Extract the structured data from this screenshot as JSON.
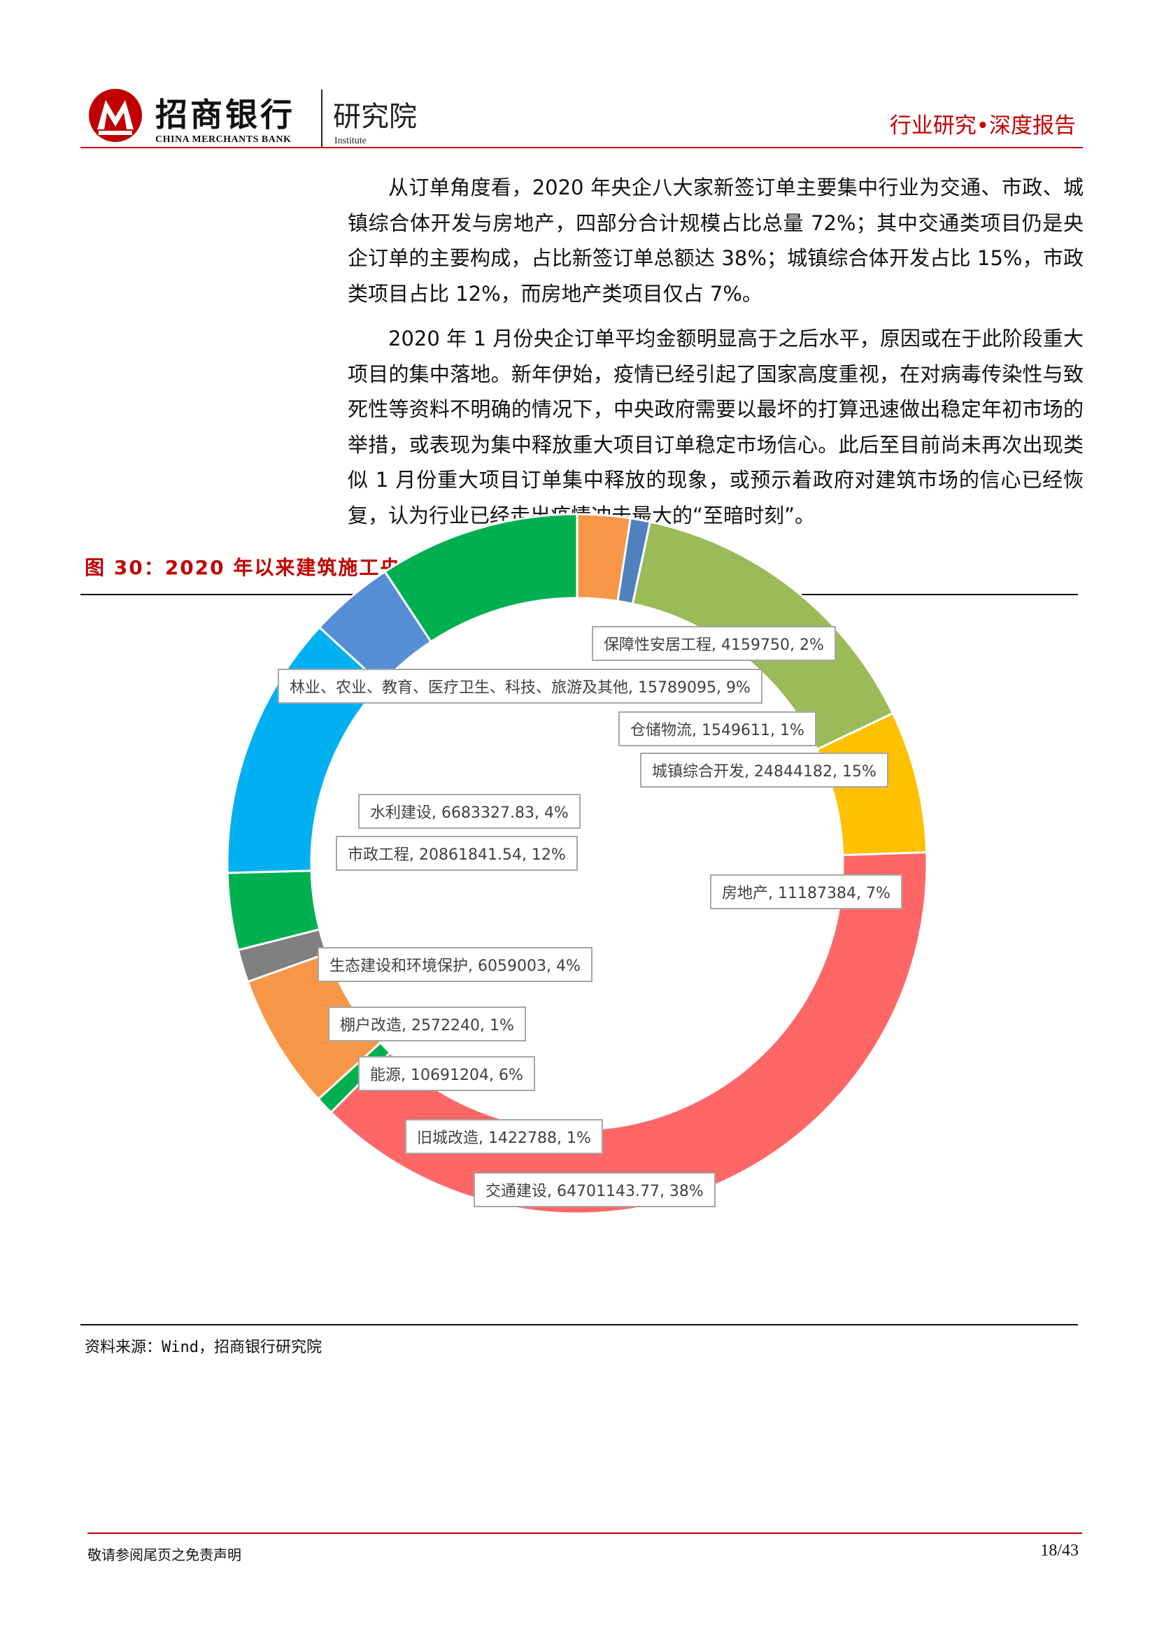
{
  "header": {
    "brand_cn": "招商银行",
    "brand_en": "CHINA MERCHANTS BANK",
    "institute_cn": "研究院",
    "institute_en": "Institute",
    "report_type": "行业研究•深度报告",
    "accent_color": "#c00000"
  },
  "body": {
    "paragraphs": [
      "从订单角度看，2020 年央企八大家新签订单主要集中行业为交通、市政、城镇综合体开发与房地产，四部分合计规模占比总量 72%；其中交通类项目仍是央企订单的主要构成，占比新签订单总额达 38%；城镇综合体开发占比 15%，市政类项目占比 12%，而房地产类项目仅占 7%。",
      "2020 年 1 月份央企订单平均金额明显高于之后水平，原因或在于此阶段重大项目的集中落地。新年伊始，疫情已经引起了国家高度重视，在对病毒传染性与致死性等资料不明确的情况下，中央政府需要以最坏的打算迅速做出稳定年初市场的举措，或表现为集中释放重大项目订单稳定市场信心。此后至目前尚未再次出现类似 1 月份重大项目订单集中释放的现象，或预示着政府对建筑市场的信心已经恢复，认为行业已经走出疫情冲击最大的“至暗时刻”。"
    ]
  },
  "figure": {
    "title": "图 30：2020 年以来建筑施工央企八大家中标订单行业分布情况",
    "source": "资料来源：Wind，招商银行研究院"
  },
  "chart_data": {
    "type": "pie",
    "variant": "doughnut",
    "title": "",
    "slices": [
      {
        "name": "保障性安居工程",
        "value": 4159750,
        "percent": "2%",
        "label": "保障性安居工程, 4159750, 2%",
        "color": "#f79646"
      },
      {
        "name": "仓储物流",
        "value": 1549611,
        "percent": "1%",
        "label": "仓储物流, 1549611, 1%",
        "color": "#4f81bd"
      },
      {
        "name": "城镇综合开发",
        "value": 24844182,
        "percent": "15%",
        "label": "城镇综合开发, 24844182, 15%",
        "color": "#9bbb59"
      },
      {
        "name": "房地产",
        "value": 11187384,
        "percent": "7%",
        "label": "房地产, 11187384, 7%",
        "color": "#ffc000"
      },
      {
        "name": "交通建设",
        "value": 64701143.77,
        "percent": "38%",
        "label": "交通建设, 64701143.77, 38%",
        "color": "#ff6666"
      },
      {
        "name": "旧城改造",
        "value": 1422788,
        "percent": "1%",
        "label": "旧城改造, 1422788, 1%",
        "color": "#00b050"
      },
      {
        "name": "能源",
        "value": 10691204,
        "percent": "6%",
        "label": "能源, 10691204, 6%",
        "color": "#f79646"
      },
      {
        "name": "棚户改造",
        "value": 2572240,
        "percent": "1%",
        "label": "棚户改造, 2572240, 1%",
        "color": "#808080"
      },
      {
        "name": "生态建设和环境保护",
        "value": 6059003,
        "percent": "4%",
        "label": "生态建设和环境保护, 6059003, 4%",
        "color": "#00b050"
      },
      {
        "name": "市政工程",
        "value": 20861841.54,
        "percent": "12%",
        "label": "市政工程, 20861841.54, 12%",
        "color": "#00b0f0"
      },
      {
        "name": "水利建设",
        "value": 6683327.83,
        "percent": "4%",
        "label": "水利建设, 6683327.83, 4%",
        "color": "#558ed5"
      },
      {
        "name": "林业、农业、教育、医疗卫生、科技、旅游及其他",
        "value": 15789095,
        "percent": "9%",
        "label": "林业、农业、教育、医疗卫生、科技、旅游及其他, 15789095, 9%",
        "color": "#00b050"
      }
    ],
    "legend": "none"
  },
  "footer": {
    "disclaimer": "敬请参阅尾页之免责声明",
    "page": "18/43"
  }
}
